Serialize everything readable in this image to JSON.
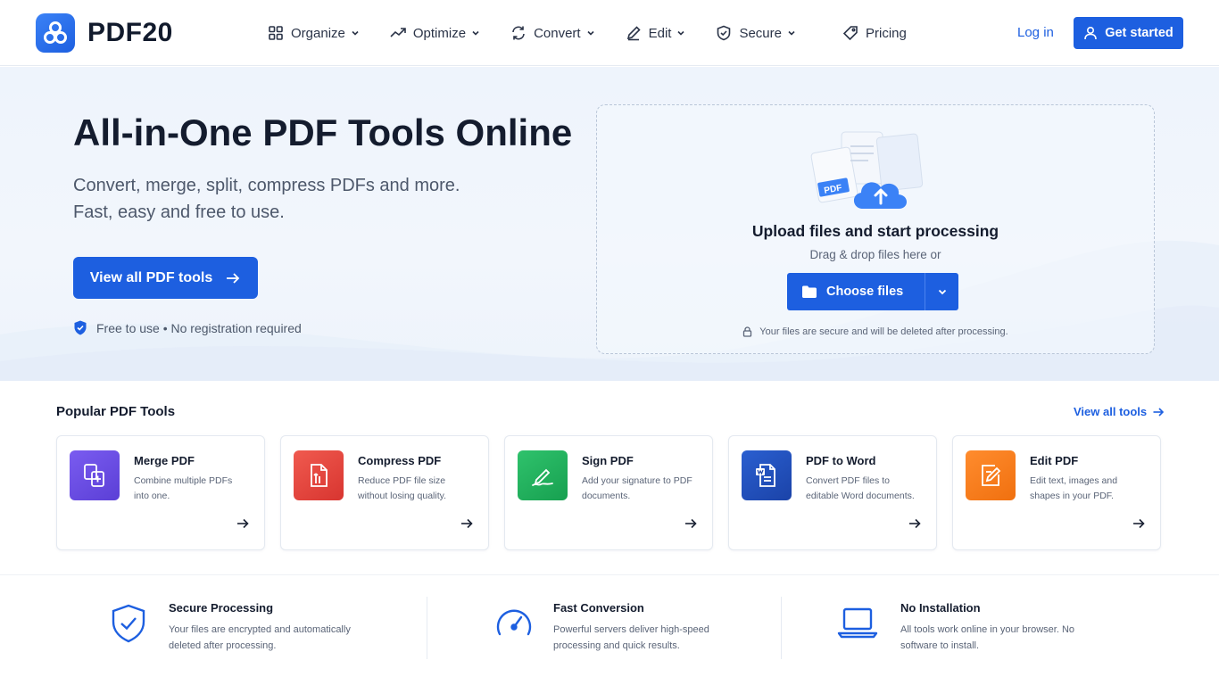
{
  "brand": {
    "name": "PDF20"
  },
  "nav": {
    "items": [
      {
        "label": "Organize",
        "icon": "grid-icon",
        "has_dropdown": true
      },
      {
        "label": "Optimize",
        "icon": "trend-icon",
        "has_dropdown": true
      },
      {
        "label": "Convert",
        "icon": "refresh-icon",
        "has_dropdown": true
      },
      {
        "label": "Edit",
        "icon": "pencil-icon",
        "has_dropdown": true
      },
      {
        "label": "Secure",
        "icon": "shield-check-icon",
        "has_dropdown": true
      },
      {
        "label": "Pricing",
        "icon": "tag-icon",
        "has_dropdown": false
      }
    ],
    "login": "Log in",
    "get_started": "Get started"
  },
  "hero": {
    "title": "All-in-One PDF Tools Online",
    "subtitle_line1": "Convert, merge, split, compress PDFs and more.",
    "subtitle_line2": "Fast, easy and free to use.",
    "cta": "View all PDF tools",
    "free_note": "Free to use • No registration required"
  },
  "upload": {
    "art_badge": "PDF",
    "title": "Upload files and start processing",
    "subtitle": "Drag & drop files here or",
    "choose_button": "Choose files",
    "secure_note": "Your files are secure and will be deleted after processing."
  },
  "tools": {
    "heading": "Popular PDF Tools",
    "view_all": "View all tools",
    "items": [
      {
        "title": "Merge PDF",
        "desc": "Combine multiple PDFs into one.",
        "icon": "merge-icon",
        "color": "#6a4fe0"
      },
      {
        "title": "Compress PDF",
        "desc": "Reduce PDF file size without losing quality.",
        "icon": "compress-icon",
        "color": "#e5403d"
      },
      {
        "title": "Sign PDF",
        "desc": "Add your signature to PDF documents.",
        "icon": "signature-icon",
        "color": "#1fae5b"
      },
      {
        "title": "PDF to Word",
        "desc": "Convert PDF files to editable Word documents.",
        "icon": "word-doc-icon",
        "color": "#1f4fbf"
      },
      {
        "title": "Edit PDF",
        "desc": "Edit text, images and shapes in your PDF.",
        "icon": "edit-doc-icon",
        "color": "#f57c1f"
      }
    ]
  },
  "features": [
    {
      "title": "Secure Processing",
      "desc": "Your files are encrypted and automatically deleted after processing.",
      "icon": "shield-check-icon"
    },
    {
      "title": "Fast Conversion",
      "desc": "Powerful servers deliver high-speed processing and quick results.",
      "icon": "speedometer-icon"
    },
    {
      "title": "No Installation",
      "desc": "All tools work online in your browser. No software to install.",
      "icon": "laptop-icon"
    }
  ],
  "colors": {
    "primary": "#1d5fe0",
    "text": "#141c2e",
    "muted": "#5a6477"
  }
}
